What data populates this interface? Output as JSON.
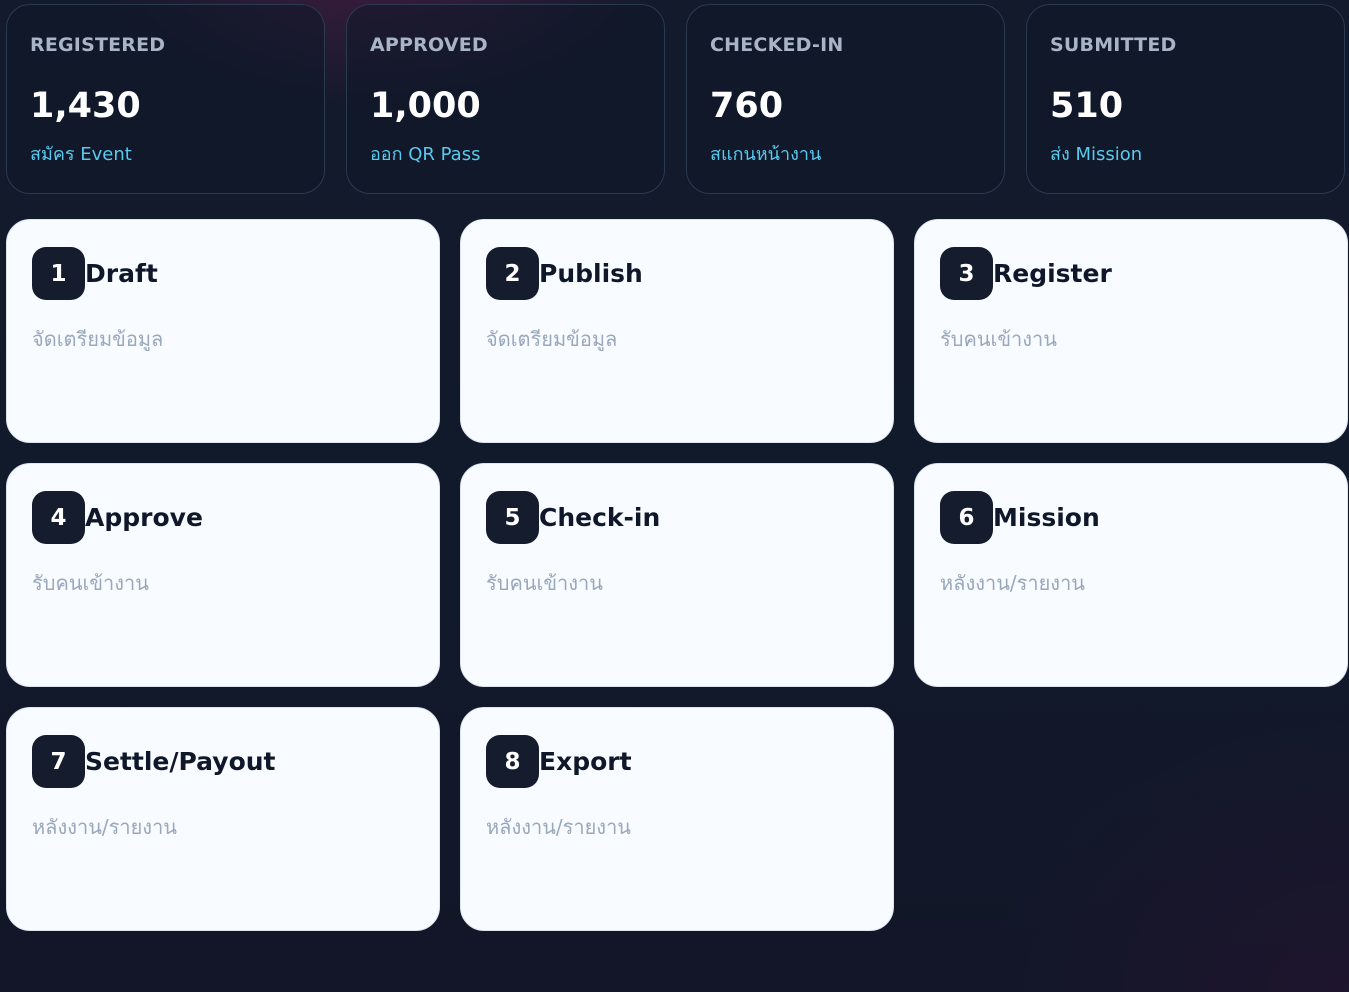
{
  "stats": [
    {
      "label": "REGISTERED",
      "value": "1,430",
      "sub": "สมัคร Event"
    },
    {
      "label": "APPROVED",
      "value": "1,000",
      "sub": "ออก QR Pass"
    },
    {
      "label": "CHECKED-IN",
      "value": "760",
      "sub": "สแกนหน้างาน"
    },
    {
      "label": "SUBMITTED",
      "value": "510",
      "sub": "ส่ง Mission"
    }
  ],
  "steps": [
    {
      "number": "1",
      "title": "Draft",
      "desc": "จัดเตรียมข้อมูล"
    },
    {
      "number": "2",
      "title": "Publish",
      "desc": "จัดเตรียมข้อมูล"
    },
    {
      "number": "3",
      "title": "Register",
      "desc": "รับคนเข้างาน"
    },
    {
      "number": "4",
      "title": "Approve",
      "desc": "รับคนเข้างาน"
    },
    {
      "number": "5",
      "title": "Check-in",
      "desc": "รับคนเข้างาน"
    },
    {
      "number": "6",
      "title": "Mission",
      "desc": "หลังงาน/รายงาน"
    },
    {
      "number": "7",
      "title": "Settle/Payout",
      "desc": "หลังงาน/รายงาน"
    },
    {
      "number": "8",
      "title": "Export",
      "desc": "หลังงาน/รายงาน"
    }
  ],
  "colors": {
    "background": "#111a2b",
    "stat_card_border": "#2a3a52",
    "stat_label": "#a9b4c6",
    "stat_value": "#ffffff",
    "stat_sub": "#59c9ee",
    "step_card_bg": "#f8fbff",
    "step_badge_bg": "#141c2e",
    "step_title": "#0f172a",
    "step_desc": "#9aa8bc"
  }
}
